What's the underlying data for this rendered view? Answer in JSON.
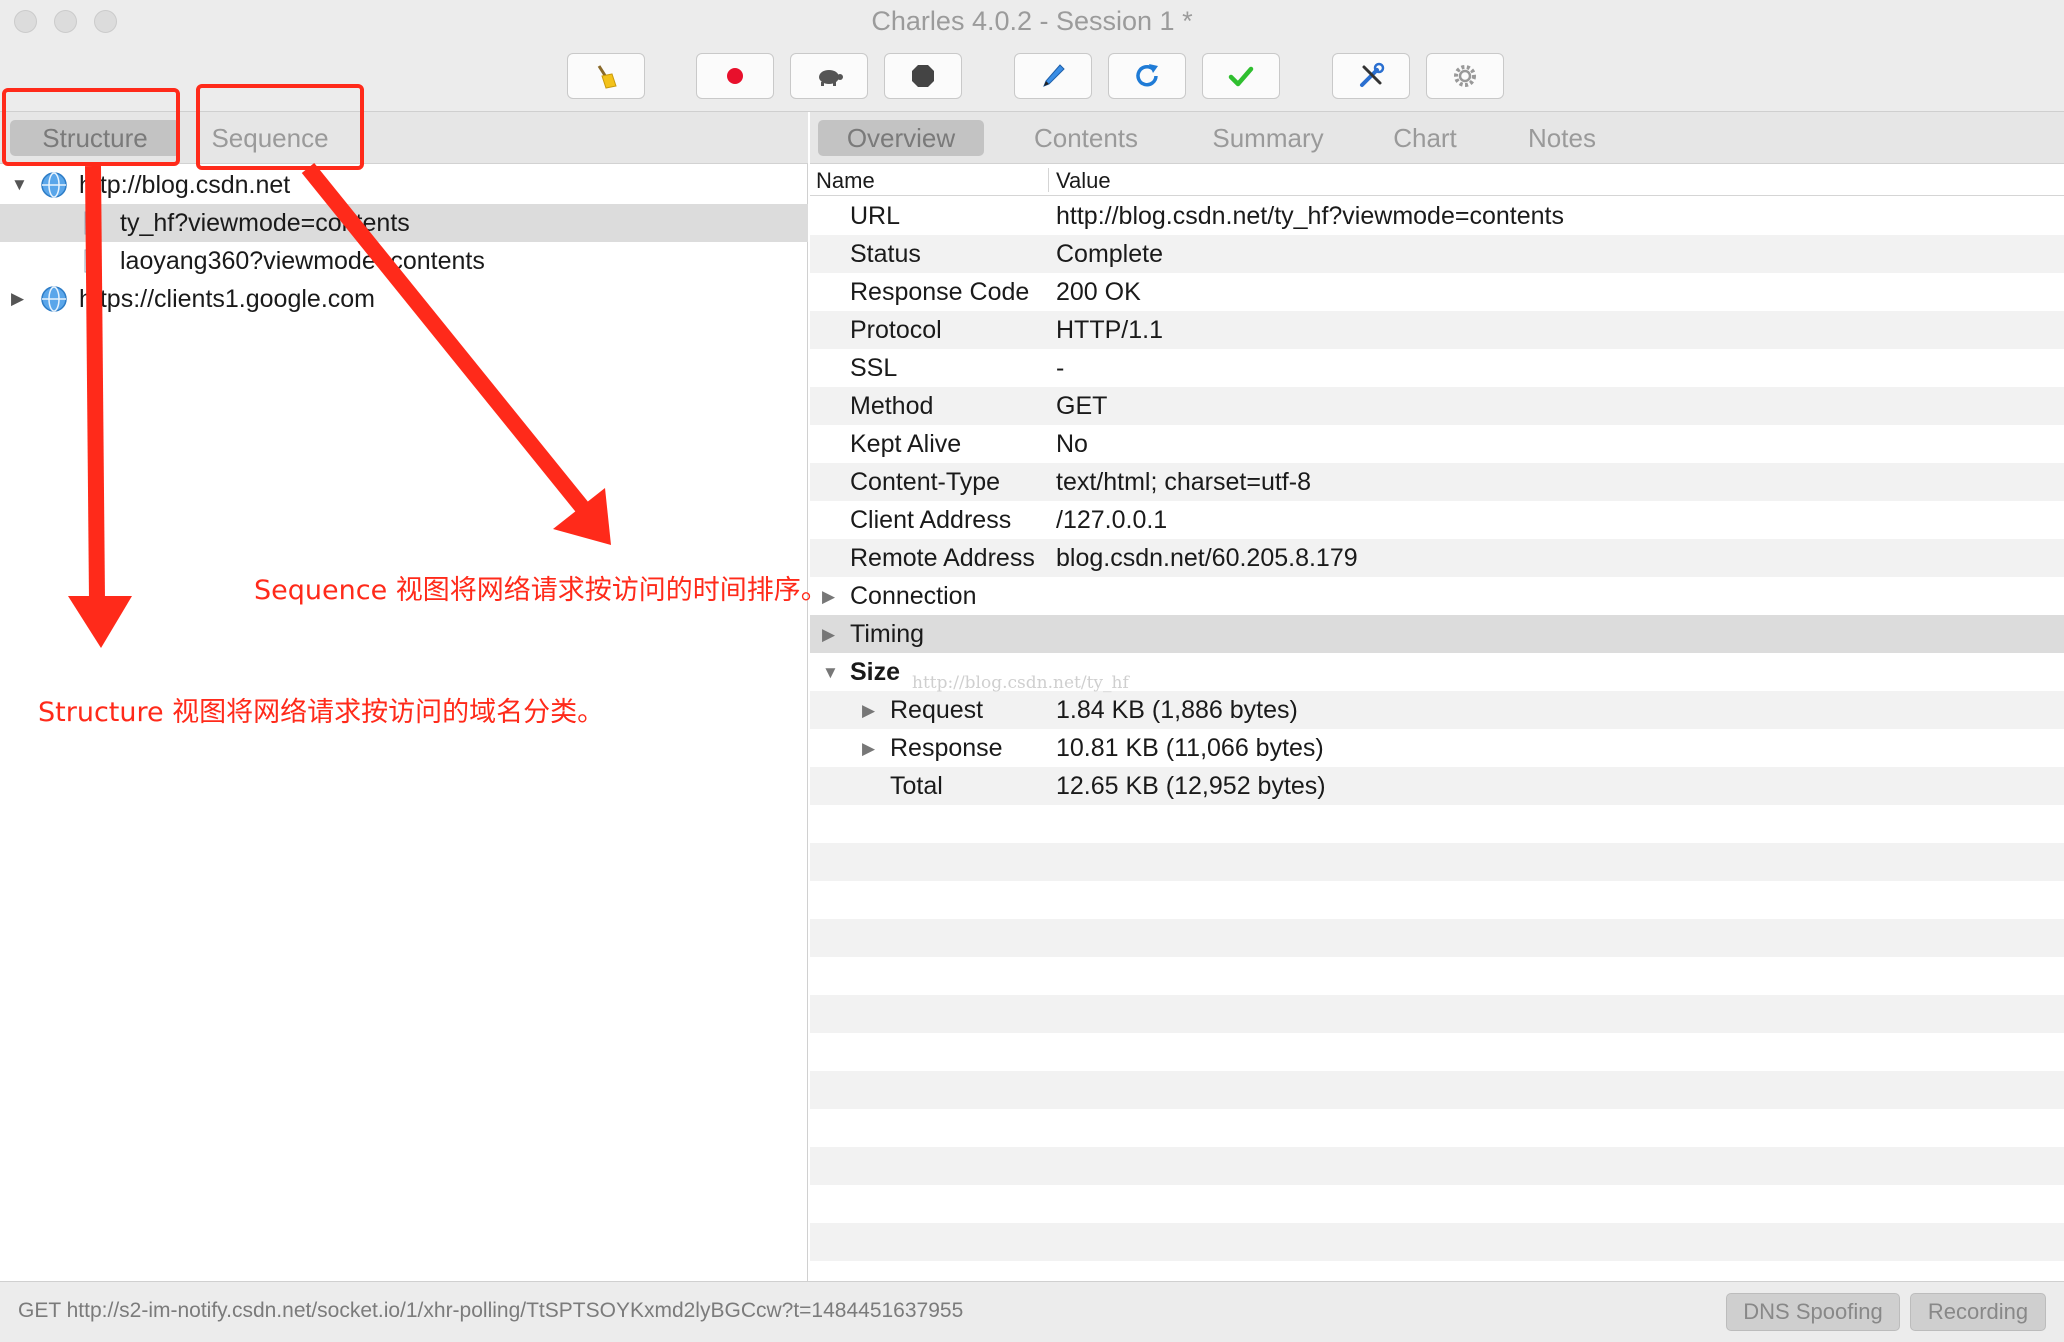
{
  "window": {
    "title": "Charles 4.0.2 - Session 1 *"
  },
  "toolbar": {
    "buttons": [
      {
        "name": "broom-icon"
      },
      {
        "name": "record-icon"
      },
      {
        "name": "turtle-icon"
      },
      {
        "name": "stop-icon"
      },
      {
        "name": "pen-icon"
      },
      {
        "name": "refresh-icon"
      },
      {
        "name": "checkmark-icon"
      },
      {
        "name": "tools-icon"
      },
      {
        "name": "gear-icon"
      }
    ]
  },
  "left_tabs": {
    "structure": "Structure",
    "sequence": "Sequence"
  },
  "right_tabs": {
    "overview": "Overview",
    "contents": "Contents",
    "summary": "Summary",
    "chart": "Chart",
    "notes": "Notes"
  },
  "tree": {
    "host1": "http://blog.csdn.net",
    "child1": "ty_hf?viewmode=contents",
    "child2": "laoyang360?viewmode=contents",
    "host2": "https://clients1.google.com"
  },
  "overview": {
    "col_name": "Name",
    "col_value": "Value",
    "rows": [
      {
        "name": "URL",
        "value": "http://blog.csdn.net/ty_hf?viewmode=contents"
      },
      {
        "name": "Status",
        "value": "Complete"
      },
      {
        "name": "Response Code",
        "value": "200 OK"
      },
      {
        "name": "Protocol",
        "value": "HTTP/1.1"
      },
      {
        "name": "SSL",
        "value": "-"
      },
      {
        "name": "Method",
        "value": "GET"
      },
      {
        "name": "Kept Alive",
        "value": "No"
      },
      {
        "name": "Content-Type",
        "value": "text/html; charset=utf-8"
      },
      {
        "name": "Client Address",
        "value": "/127.0.0.1"
      },
      {
        "name": "Remote Address",
        "value": "blog.csdn.net/60.205.8.179"
      }
    ],
    "connection": "Connection",
    "timing": "Timing",
    "size": "Size",
    "request": {
      "name": "Request",
      "value": "1.84 KB (1,886 bytes)"
    },
    "response": {
      "name": "Response",
      "value": "10.81 KB (11,066 bytes)"
    },
    "total": {
      "name": "Total",
      "value": "12.65 KB (12,952 bytes)"
    },
    "watermark": "http://blog.csdn.net/ty_hf"
  },
  "statusbar": {
    "text": "GET http://s2-im-notify.csdn.net/socket.io/1/xhr-polling/TtSPTSOYKxmd2lyBGCcw?t=1484451637955",
    "dns_spoofing": "DNS Spoofing",
    "recording": "Recording"
  },
  "annotations": {
    "sequence_note": "Sequence 视图将网络请求按访问的时间排序。",
    "structure_note": "Structure 视图将网络请求按访问的域名分类。"
  },
  "colors": {
    "annotation": "#ff2a1a",
    "record": "#e8102c",
    "refresh": "#1f7bd6",
    "check": "#2fbf2f"
  }
}
